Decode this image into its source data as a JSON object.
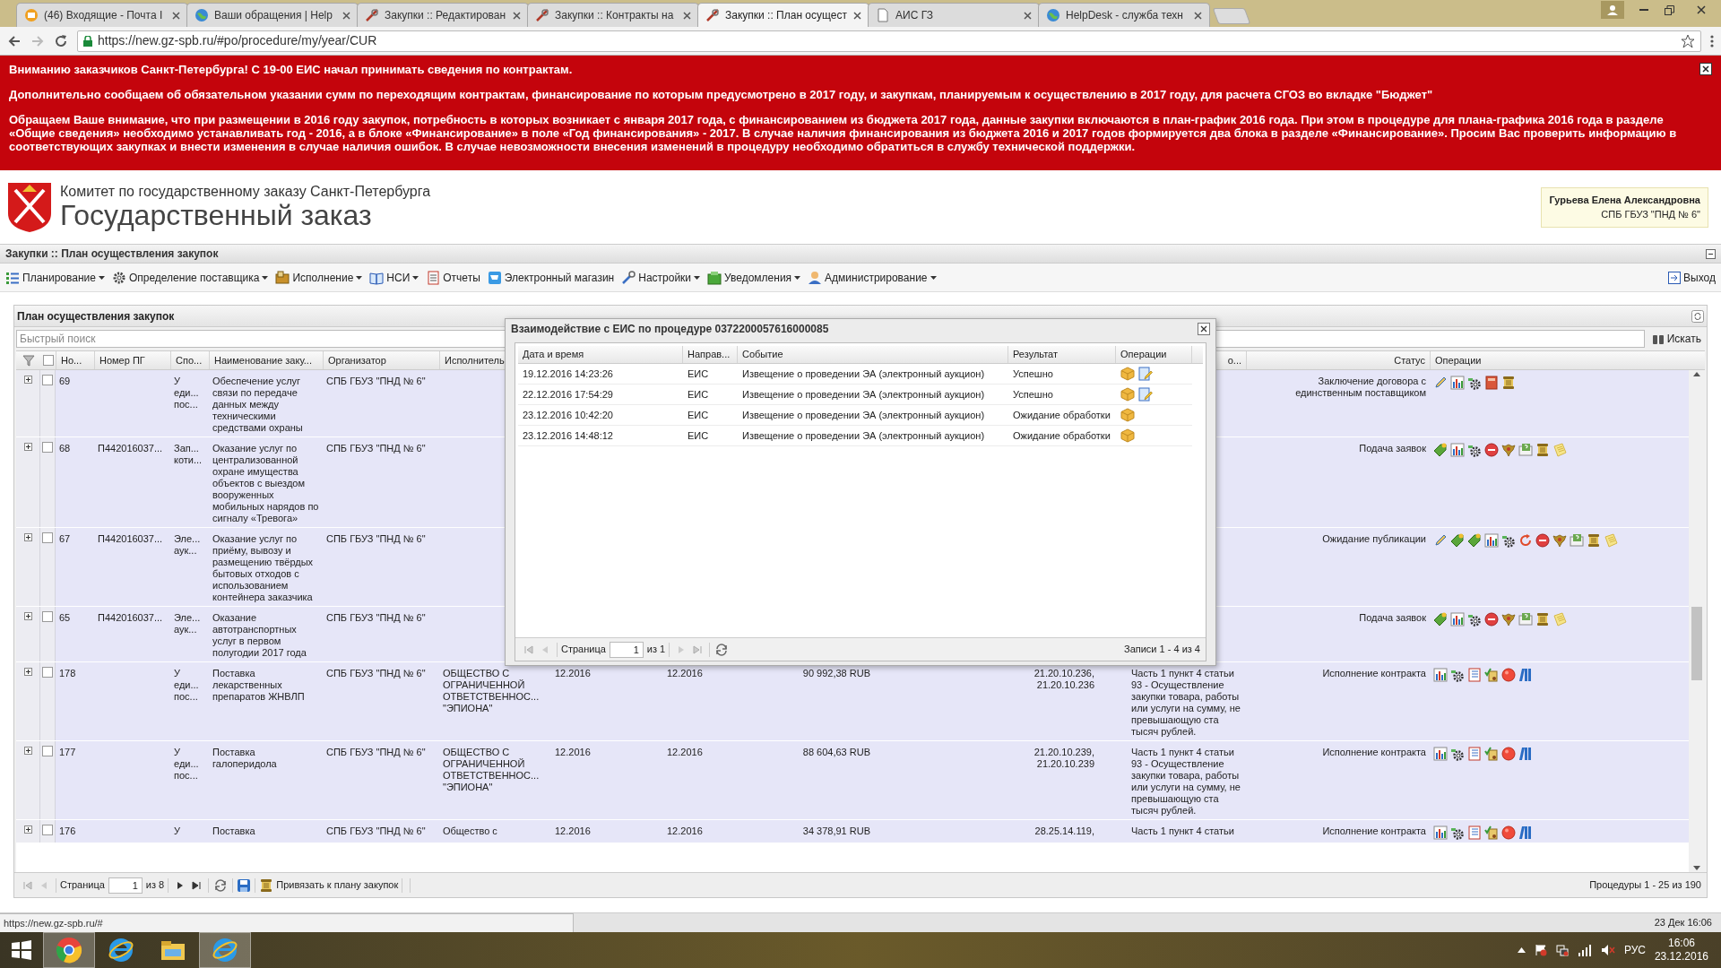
{
  "browser": {
    "tabs": [
      {
        "title": "(46) Входящие - Почта I",
        "kind": "mail",
        "selected": false
      },
      {
        "title": "Ваши обращения | Help",
        "kind": "globe",
        "selected": false
      },
      {
        "title": "Закупки :: Редактирован",
        "kind": "tool",
        "selected": false
      },
      {
        "title": "Закупки :: Контракты на",
        "kind": "tool",
        "selected": false
      },
      {
        "title": "Закупки :: План осущест",
        "kind": "tool",
        "selected": true
      },
      {
        "title": "АИС ГЗ",
        "kind": "page",
        "selected": false
      },
      {
        "title": "HelpDesk - служба техн",
        "kind": "globe",
        "selected": false
      }
    ],
    "url": "https://new.gz-spb.ru/#po/procedure/my/year/CUR"
  },
  "banner": {
    "paragraphs": [
      "Вниманию заказчиков Санкт-Петербурга! С 19-00 ЕИС начал принимать сведения по контрактам.",
      "Дополнительно сообщаем об обязательном указании сумм по переходящим контрактам, финансирование по которым предусмотрено в 2017 году, и закупкам, планируемым к осуществлению в 2017 году, для расчета СГОЗ во вкладке \"Бюджет\"",
      "Обращаем Ваше внимание, что при размещении в 2016 году закупок, потребность в которых возникает с января 2017 года, с финансированием из бюджета 2017 года, данные закупки включаются в план-график 2016 года. При этом в процедуре для плана-графика 2016 года в разделе «Общие сведения» необходимо устанавливать год - 2016, а в блоке «Финансирование» в поле «Год финансирования» - 2017. В случае наличия финансирования из бюджета 2016 и 2017 годов формируется два блока в разделе «Финансирование». Просим Вас проверить информацию в соответствующих закупках и внести изменения в случае наличия ошибок. В случае невозможности внесения изменений в процедуру необходимо обратиться в службу технической поддержки."
    ]
  },
  "header": {
    "subtitle": "Комитет по государственному заказу Санкт-Петербурга",
    "title": "Государственный заказ",
    "user": {
      "name": "Гурьева Елена Александровна",
      "org": "СПБ ГБУЗ \"ПНД № 6\""
    }
  },
  "page_title": "Закупки :: План осуществления закупок",
  "menu": {
    "items": [
      {
        "label": "Планирование",
        "dropdown": true
      },
      {
        "label": "Определение поставщика",
        "dropdown": true
      },
      {
        "label": "Исполнение",
        "dropdown": true
      },
      {
        "label": "НСИ",
        "dropdown": true
      },
      {
        "label": "Отчеты",
        "dropdown": false
      },
      {
        "label": "Электронный магазин",
        "dropdown": false
      },
      {
        "label": "Настройки",
        "dropdown": true
      },
      {
        "label": "Уведомления",
        "dropdown": true
      },
      {
        "label": "Администрирование",
        "dropdown": true
      }
    ],
    "logout": "Выход"
  },
  "panel": {
    "title": "План осуществления закупок",
    "search": {
      "placeholder": "Быстрый поиск",
      "button": "Искать"
    },
    "table": {
      "all_checked": false,
      "columns": [
        "Но...",
        "Номер ПГ",
        "Спо...",
        "Наименование заку...",
        "Организатор",
        "Исполнитель",
        "о...",
        "Статус",
        "Операции"
      ],
      "rows": [
        {
          "expanded": false,
          "checked": false,
          "number": "69",
          "method": [
            "У",
            "еди...",
            "пос..."
          ],
          "name": "Обеспечение услуг связи по передаче данных между техническими средствами охраны",
          "organizer": "СПБ ГБУЗ \"ПНД № 6\"",
          "status": "Заключение договора с единственным поставщиком",
          "operations": [
            {
              "kind": "pencil"
            },
            {
              "kind": "chart"
            },
            {
              "kind": "gear"
            },
            {
              "kind": "book"
            },
            {
              "kind": "scroll"
            }
          ]
        },
        {
          "expanded": false,
          "checked": false,
          "number": "68",
          "pg": "П442016037...",
          "method": [
            "Зап...",
            "коти..."
          ],
          "name": "Оказание услуг по централизованной охране имущества объектов с выездом вооруженных мобильных нарядов по сигналу «Тревога»",
          "organizer": "СПБ ГБУЗ \"ПНД № 6\"",
          "status": "Подача заявок",
          "operations": [
            {
              "kind": "tag"
            },
            {
              "kind": "chart"
            },
            {
              "kind": "gear"
            },
            {
              "kind": "stop"
            },
            {
              "kind": "emblem"
            },
            {
              "kind": "query"
            },
            {
              "kind": "scroll"
            },
            {
              "kind": "note"
            }
          ]
        },
        {
          "expanded": false,
          "checked": false,
          "number": "67",
          "pg": "П442016037...",
          "method": [
            "Эле...",
            "аук..."
          ],
          "name": "Оказание услуг по приёму, вывозу и размещению твёрдых бытовых отходов с использованием контейнера заказчика",
          "organizer": "СПБ ГБУЗ \"ПНД № 6\"",
          "status": "Ожидание публикации",
          "operations": [
            {
              "kind": "pencil"
            },
            {
              "kind": "tag"
            },
            {
              "kind": "tag"
            },
            {
              "kind": "chart"
            },
            {
              "kind": "gear"
            },
            {
              "kind": "refresh"
            },
            {
              "kind": "stop"
            },
            {
              "kind": "emblem"
            },
            {
              "kind": "query"
            },
            {
              "kind": "scroll"
            },
            {
              "kind": "note"
            }
          ]
        },
        {
          "expanded": false,
          "checked": false,
          "number": "65",
          "pg": "П442016037...",
          "method": [
            "Эле...",
            "аук..."
          ],
          "name": "Оказание автотранспортных услуг в первом полугодии 2017 года",
          "organizer": "СПБ ГБУЗ \"ПНД № 6\"",
          "status": "Подача заявок",
          "operations": [
            {
              "kind": "tag"
            },
            {
              "kind": "chart"
            },
            {
              "kind": "gear"
            },
            {
              "kind": "stop"
            },
            {
              "kind": "emblem"
            },
            {
              "kind": "query"
            },
            {
              "kind": "scroll"
            },
            {
              "kind": "note"
            }
          ]
        },
        {
          "expanded": false,
          "checked": false,
          "number": "178",
          "method": [
            "У",
            "еди...",
            "пос..."
          ],
          "name": "Поставка лекарственных препаратов ЖНВЛП",
          "organizer": "СПБ ГБУЗ \"ПНД № 6\"",
          "executor": [
            "ОБЩЕСТВО С",
            "ОГРАНИЧЕННОЙ",
            "ОТВЕТСТВЕННОС...",
            "\"ЭПИОНА\""
          ],
          "start": "12.2016",
          "end": "12.2016",
          "amount": "90 992,38 RUB",
          "codes": "21.20.10.236, 21.20.10.236",
          "basis": "Часть 1 пункт 4 статьи 93 - Осуществление закупки товара, работы или услуги на сумму, не превышающую ста тысяч рублей.",
          "status": "Исполнение контракта",
          "operations": [
            {
              "kind": "chart"
            },
            {
              "kind": "gear"
            },
            {
              "kind": "list"
            },
            {
              "kind": "sign"
            },
            {
              "kind": "record"
            },
            {
              "kind": "binders"
            }
          ]
        },
        {
          "expanded": false,
          "checked": false,
          "number": "177",
          "method": [
            "У",
            "еди...",
            "пос..."
          ],
          "name": "Поставка галоперидола",
          "organizer": "СПБ ГБУЗ \"ПНД № 6\"",
          "executor": [
            "ОБЩЕСТВО С",
            "ОГРАНИЧЕННОЙ",
            "ОТВЕТСТВЕННОС...",
            "\"ЭПИОНА\""
          ],
          "start": "12.2016",
          "end": "12.2016",
          "amount": "88 604,63 RUB",
          "codes": "21.20.10.239, 21.20.10.239",
          "basis": "Часть 1 пункт 4 статьи 93 - Осуществление закупки товара, работы или услуги на сумму, не превышающую ста тысяч рублей.",
          "status": "Исполнение контракта",
          "operations": [
            {
              "kind": "chart"
            },
            {
              "kind": "gear"
            },
            {
              "kind": "list"
            },
            {
              "kind": "sign"
            },
            {
              "kind": "record"
            },
            {
              "kind": "binders"
            }
          ]
        },
        {
          "expanded": false,
          "checked": false,
          "number": "176",
          "method": [
            "У"
          ],
          "name": "Поставка",
          "organizer": "СПБ ГБУЗ \"ПНД № 6\"",
          "executor": [
            "Общество с"
          ],
          "start": "12.2016",
          "end": "12.2016",
          "amount": "34 378,91 RUB",
          "codes": "28.25.14.119,",
          "basis": "Часть 1 пункт 4 статьи",
          "status": "Исполнение контракта",
          "operations": [
            {
              "kind": "chart"
            },
            {
              "kind": "gear"
            },
            {
              "kind": "list"
            },
            {
              "kind": "sign"
            },
            {
              "kind": "record"
            },
            {
              "kind": "binders"
            }
          ]
        }
      ]
    },
    "pager": {
      "page_label": "Страница",
      "page": "1",
      "of": "из 8",
      "link_button": "Привязать к плану закупок",
      "summary": "Процедуры 1 - 25 из 190"
    }
  },
  "dialog": {
    "title": "Взаимодействие с ЕИС по процедуре 0372200057616000085",
    "columns": [
      "Дата и время",
      "Направ...",
      "Событие",
      "Результат",
      "Операции"
    ],
    "rows": [
      {
        "date": "19.12.2016 14:23:26",
        "direction": "ЕИС",
        "event": "Извещение о проведении ЭА (электронный аукцион)",
        "result": "Успешно",
        "operations": [
          {
            "kind": "box"
          },
          {
            "kind": "edit"
          }
        ]
      },
      {
        "date": "22.12.2016 17:54:29",
        "direction": "ЕИС",
        "event": "Извещение о проведении ЭА (электронный аукцион)",
        "result": "Успешно",
        "operations": [
          {
            "kind": "box"
          },
          {
            "kind": "edit"
          }
        ]
      },
      {
        "date": "23.12.2016 10:42:20",
        "direction": "ЕИС",
        "event": "Извещение о проведении ЭА (электронный аукцион)",
        "result": "Ожидание обработки",
        "operations": [
          {
            "kind": "box"
          }
        ]
      },
      {
        "date": "23.12.2016 14:48:12",
        "direction": "ЕИС",
        "event": "Извещение о проведении ЭА (электронный аукцион)",
        "result": "Ожидание обработки",
        "operations": [
          {
            "kind": "box"
          }
        ]
      }
    ],
    "pager": {
      "page_label": "Страница",
      "page": "1",
      "of": "из 1",
      "summary": "Записи 1 - 4 из 4"
    }
  },
  "status_url": "https://new.gz-spb.ru/#",
  "clock_bar": "23 Дек 16:06",
  "taskbar": {
    "apps": [
      {
        "kind": "ring",
        "selected": true
      },
      {
        "kind": "ie",
        "selected": false
      },
      {
        "kind": "folder",
        "selected": false
      },
      {
        "kind": "ie",
        "selected": true
      }
    ],
    "language": "РУС",
    "time": "16:06",
    "date": "23.12.2016"
  }
}
